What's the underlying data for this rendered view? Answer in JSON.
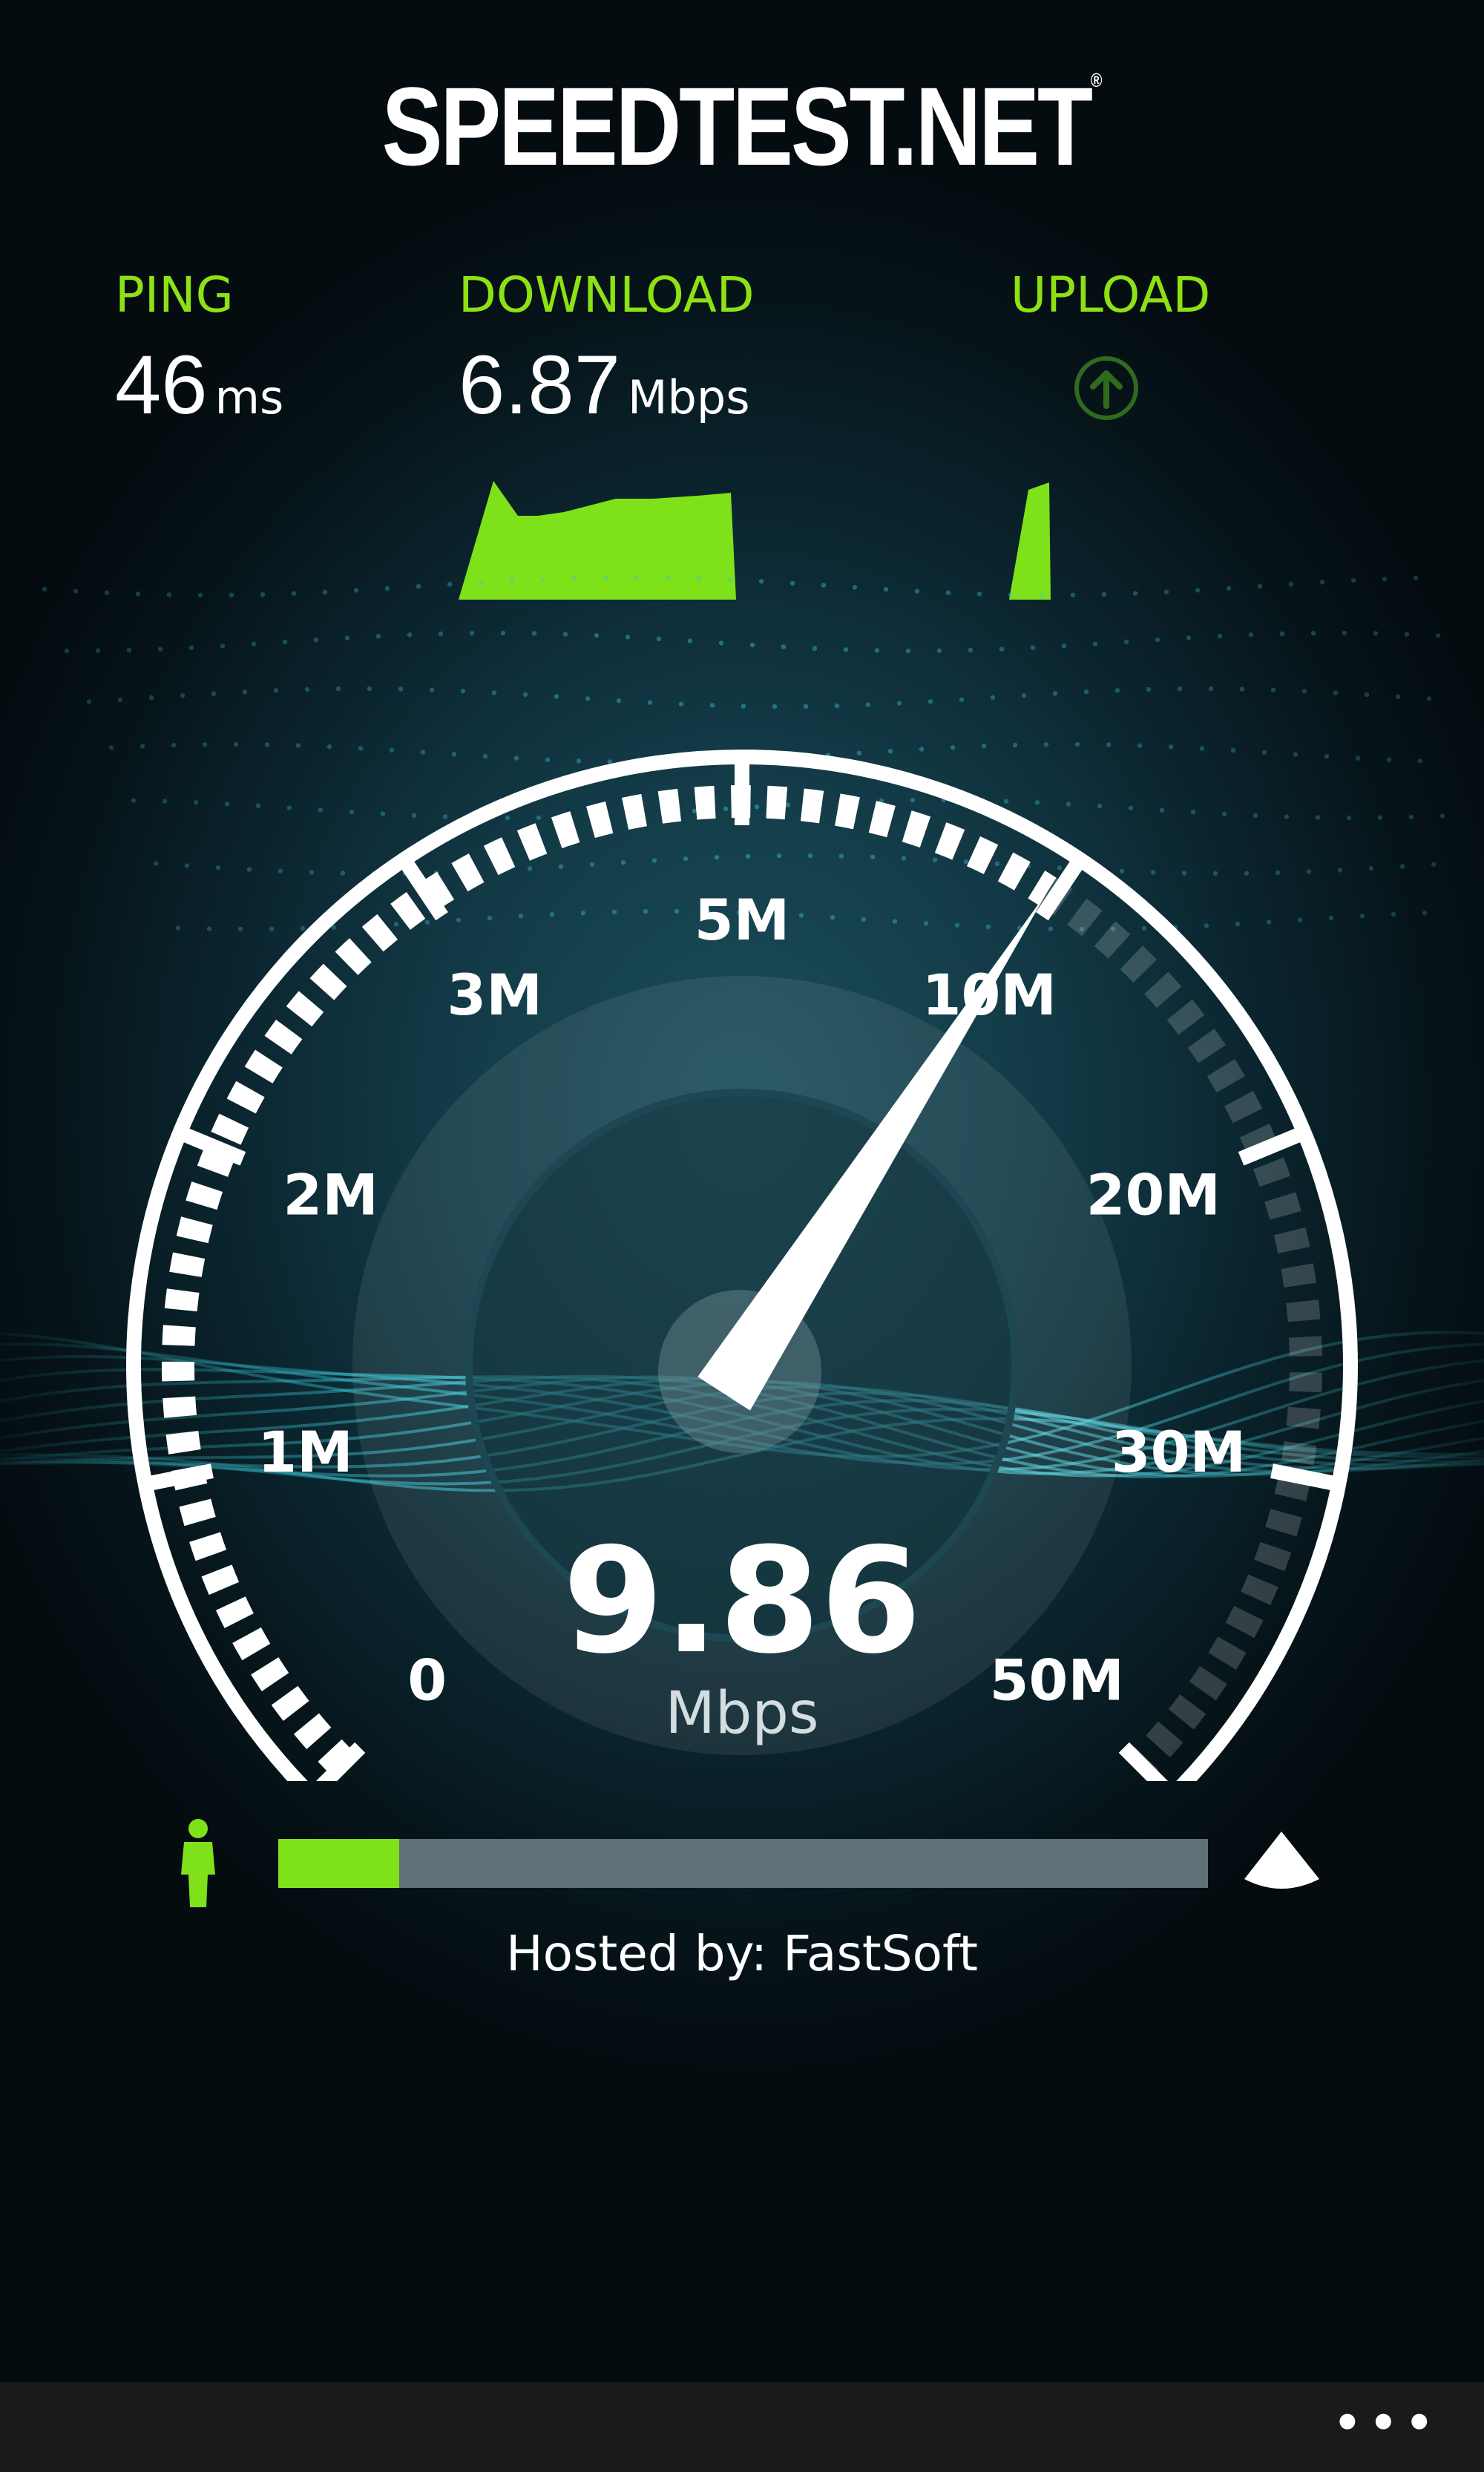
{
  "app": {
    "logo_text": "SPEEDTEST.NET",
    "logo_mark": "®"
  },
  "stats": {
    "ping": {
      "label": "PING",
      "value": "46",
      "unit": "ms"
    },
    "download": {
      "label": "DOWNLOAD",
      "value": "6.87",
      "unit": "Mbps"
    },
    "upload": {
      "label": "UPLOAD",
      "icon": "upload-arrow-icon"
    }
  },
  "gauge": {
    "ticks": [
      "0",
      "1M",
      "2M",
      "3M",
      "5M",
      "10M",
      "20M",
      "30M",
      "50M"
    ],
    "needle_value_mbps": 9.86,
    "reading": "9.86",
    "reading_unit": "Mbps"
  },
  "progress": {
    "fraction": 0.13
  },
  "server": {
    "hosted_by": "Hosted by: FastSoft"
  },
  "app_bar": {
    "more_label": "•••"
  },
  "colors": {
    "accent": "#8ee214",
    "background": "#123a46",
    "track": "#5f7177",
    "app_bar": "#1a1a1a"
  },
  "icons": {
    "person": "person-icon",
    "server": "server-icon",
    "more": "more-icon"
  }
}
